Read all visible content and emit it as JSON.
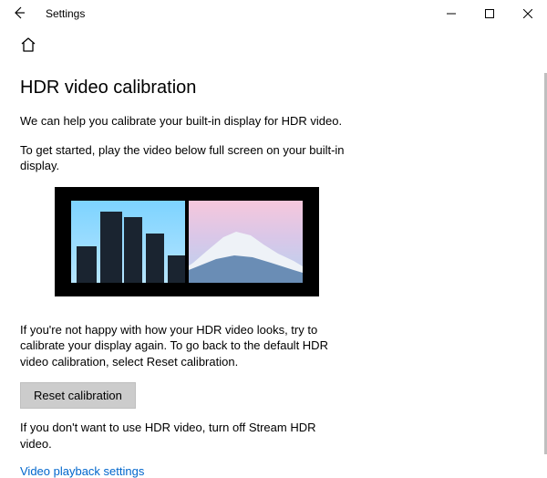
{
  "titlebar": {
    "app_title": "Settings"
  },
  "page": {
    "title": "HDR video calibration",
    "intro": "We can help you calibrate your built-in display for HDR video.",
    "instruction": "To get started, play the video below full screen on your built-in display.",
    "followup": "If you're not happy with how your HDR video looks, try to calibrate your display again. To go back to the default HDR video calibration, select Reset calibration.",
    "reset_button": "Reset calibration",
    "turnoff": "If you don't want to use HDR video, turn off Stream HDR video.",
    "link": "Video playback settings"
  }
}
